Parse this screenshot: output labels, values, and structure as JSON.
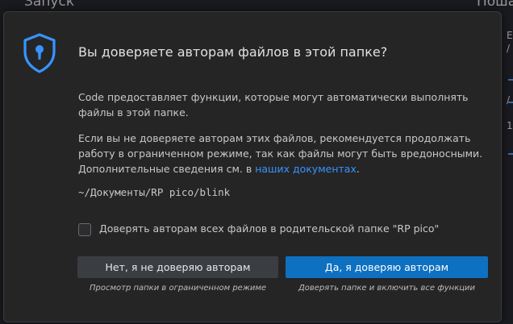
{
  "background": {
    "title_left": "Запуск",
    "title_right": "Поша",
    "side_chars": [
      "E",
      "/",
      "",
      "",
      "",
      "/",
      "",
      "1"
    ]
  },
  "dialog": {
    "title": "Вы доверяете авторам файлов в этой папке?",
    "paragraph1": "Code предоставляет функции, которые могут автоматически выполнять файлы в этой папке.",
    "paragraph2_text": "Если вы не доверяете авторам этих файлов, рекомендуется продолжать работу в ограниченном режиме, так как файлы могут быть вредоносными. Дополнительные сведения см. в ",
    "paragraph2_link": "наших документах",
    "paragraph2_end": ".",
    "folder_path": "~/Документы/RP pico/blink",
    "checkbox_label": "Доверять авторам всех файлов в родительской папке \"RP pico\"",
    "checkbox_checked": false,
    "button_no": "Нет, я не доверяю авторам",
    "button_yes": "Да, я доверяю авторам",
    "hint_no": "Просмотр папки в ограниченном режиме",
    "hint_yes": "Доверять папке и включить все функции",
    "icon": "shield-lock-icon"
  },
  "colors": {
    "accent": "#0e70c0",
    "link": "#3794ff",
    "shield": "#3794ff",
    "dialog_bg": "#252526"
  }
}
